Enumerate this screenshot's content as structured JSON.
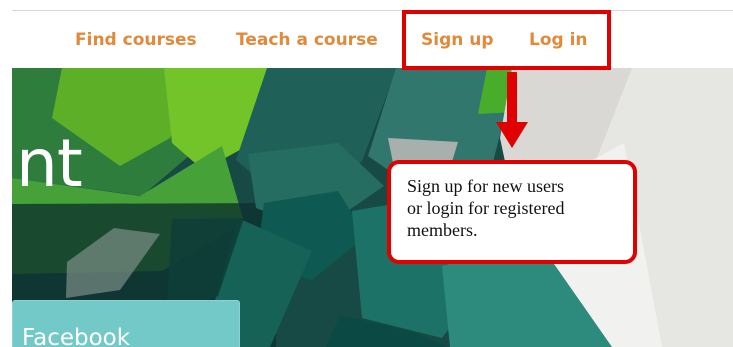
{
  "header": {
    "links": [
      {
        "label": "Find courses"
      },
      {
        "label": "Teach a course"
      },
      {
        "label": "Sign up"
      },
      {
        "label": "Log in"
      }
    ]
  },
  "hero": {
    "heading_fragment": "nt",
    "facebook_button_label": "Facebook"
  },
  "annotation": {
    "callout_text": "Sign up for new users\nor login for registered\nmembers."
  },
  "colors": {
    "nav_link": "#e08a3a",
    "annotation_red": "#e10000",
    "facebook_button": "#73c9c7"
  }
}
